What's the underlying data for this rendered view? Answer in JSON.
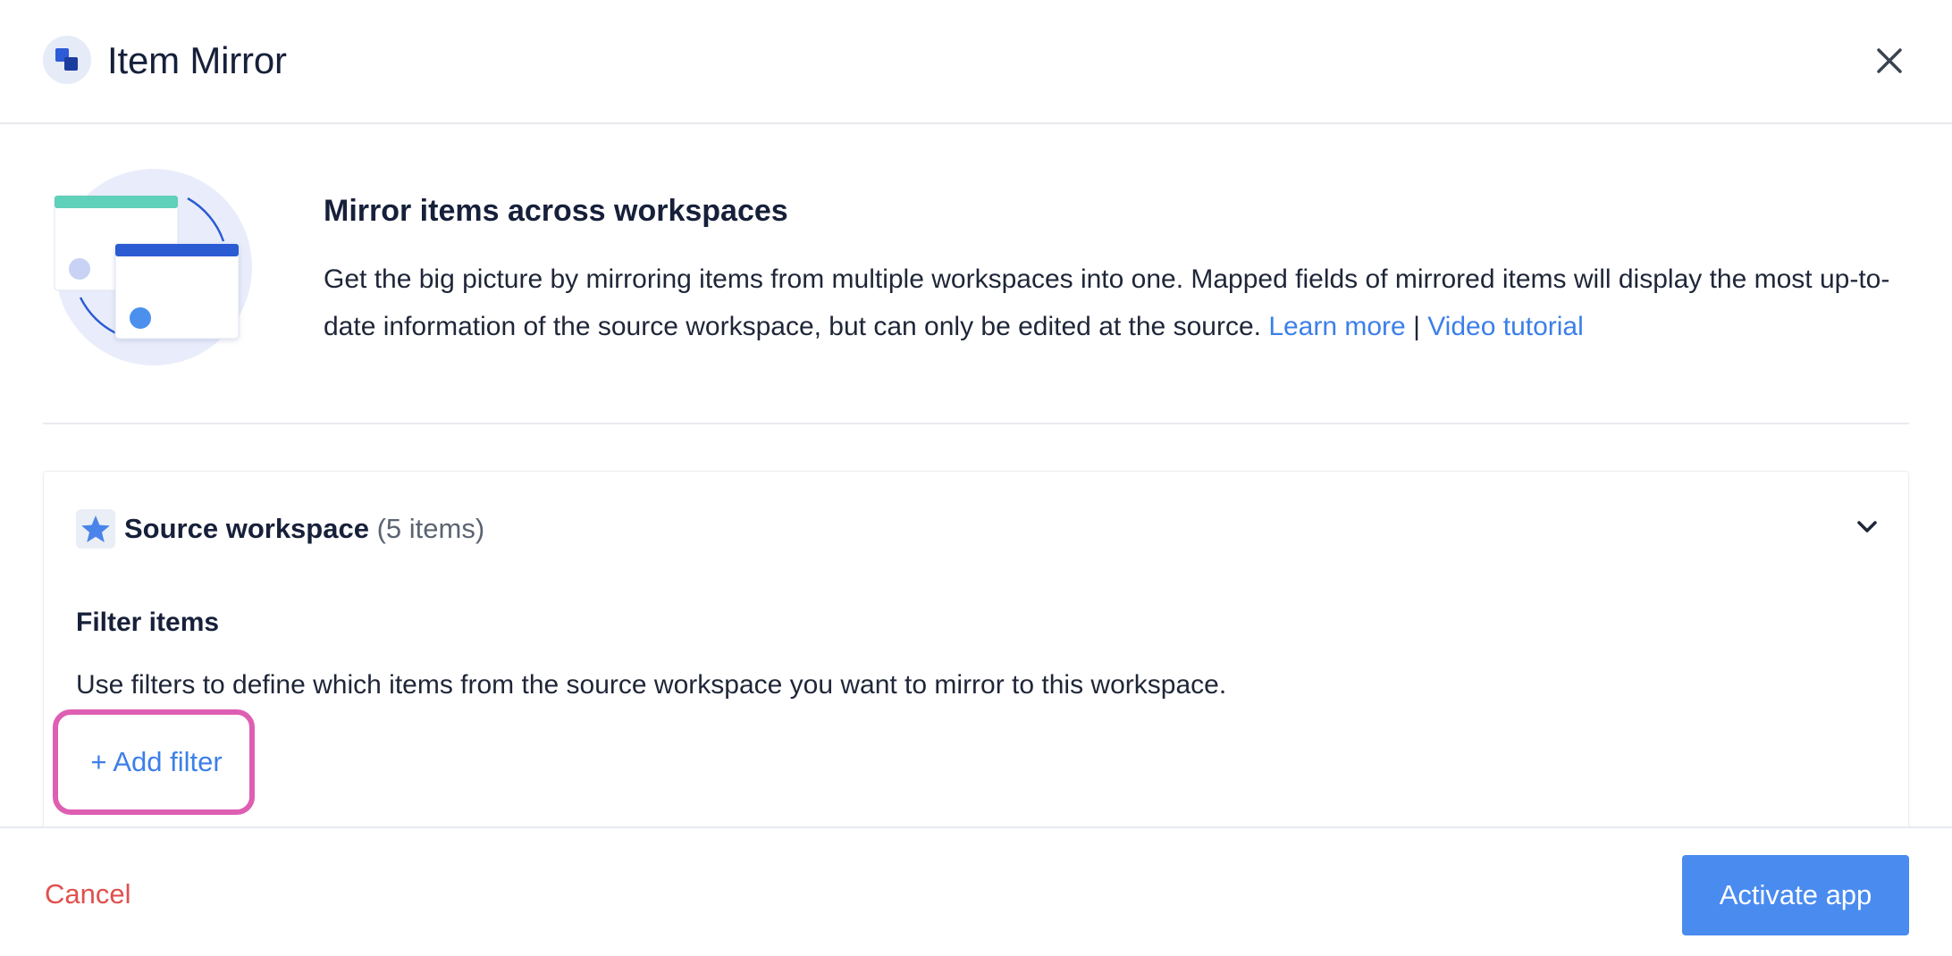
{
  "header": {
    "title": "Item Mirror",
    "logo_icon": "item-mirror-logo-icon",
    "close_icon": "close-icon"
  },
  "intro": {
    "heading": "Mirror items across workspaces",
    "text": "Get the big picture by mirroring items from multiple workspaces into one. Mapped fields of mirrored items will display the most up-to-date information of the source workspace, but can only be edited at the source.",
    "learn_more_label": "Learn more",
    "separator": "|",
    "video_tutorial_label": "Video tutorial"
  },
  "source": {
    "icon": "star-icon",
    "title": "Source workspace",
    "count": "(5 items)",
    "chevron_icon": "chevron-down-icon",
    "filter_title": "Filter items",
    "filter_description": "Use filters to define which items from the source workspace you want to mirror to this workspace.",
    "add_filter_label": "+ Add filter"
  },
  "footer": {
    "cancel_label": "Cancel",
    "activate_label": "Activate app"
  },
  "colors": {
    "link": "#3c7fe8",
    "primary_button": "#4a8bf0",
    "cancel": "#e0504e",
    "highlight": "#de5fb2"
  }
}
